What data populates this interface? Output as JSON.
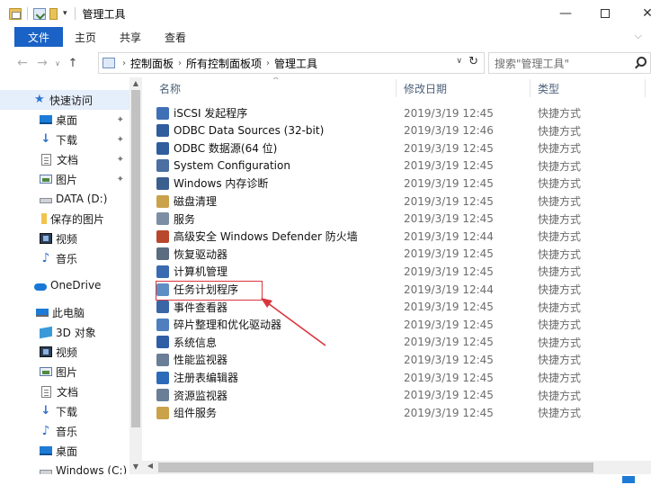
{
  "window": {
    "title": "管理工具",
    "minimize": "—",
    "close": "✕"
  },
  "ribbon": {
    "tabs": [
      "文件",
      "主页",
      "共享",
      "查看"
    ],
    "chevron": "⌵"
  },
  "nav": {
    "back": "←",
    "forward": "→",
    "recent": "∨",
    "up": "↑"
  },
  "address": {
    "crumbs": [
      "控制面板",
      "所有控制面板项",
      "管理工具"
    ],
    "separator": "›",
    "dropdown": "∨",
    "refresh": "↻"
  },
  "search": {
    "placeholder": "搜索\"管理工具\""
  },
  "sidebar": {
    "pin": "✦",
    "items": [
      {
        "label": "快速访问",
        "icon": "star-icon",
        "pinned": false
      },
      {
        "label": "桌面",
        "icon": "desktop-icon",
        "pinned": true
      },
      {
        "label": "下载",
        "icon": "download-icon",
        "pinned": true
      },
      {
        "label": "文档",
        "icon": "document-icon",
        "pinned": true
      },
      {
        "label": "图片",
        "icon": "pictures-icon",
        "pinned": true
      },
      {
        "label": "DATA (D:)",
        "icon": "drive-icon",
        "pinned": false
      },
      {
        "label": "保存的图片",
        "icon": "folder-icon",
        "pinned": false
      },
      {
        "label": "视频",
        "icon": "video-icon",
        "pinned": false
      },
      {
        "label": "音乐",
        "icon": "music-icon",
        "pinned": false
      },
      {
        "label": "OneDrive",
        "icon": "onedrive-icon",
        "pinned": false
      },
      {
        "label": "此电脑",
        "icon": "this-pc-icon",
        "pinned": false
      },
      {
        "label": "3D 对象",
        "icon": "3d-objects-icon",
        "pinned": false
      },
      {
        "label": "视频",
        "icon": "video-icon",
        "pinned": false
      },
      {
        "label": "图片",
        "icon": "pictures-icon",
        "pinned": false
      },
      {
        "label": "文档",
        "icon": "document-icon",
        "pinned": false
      },
      {
        "label": "下载",
        "icon": "download-icon",
        "pinned": false
      },
      {
        "label": "音乐",
        "icon": "music-icon",
        "pinned": false
      },
      {
        "label": "桌面",
        "icon": "desktop-icon",
        "pinned": false
      },
      {
        "label": "Windows (C:)",
        "icon": "windows-drive-icon",
        "pinned": false
      }
    ]
  },
  "columns": {
    "name": "名称",
    "date": "修改日期",
    "type": "类型"
  },
  "files": [
    {
      "name": "iSCSI 发起程序",
      "date": "2019/3/19 12:45",
      "type": "快捷方式",
      "color": "#3f6fb5"
    },
    {
      "name": "ODBC Data Sources (32-bit)",
      "date": "2019/3/19 12:46",
      "type": "快捷方式",
      "color": "#2f5d9e"
    },
    {
      "name": "ODBC 数据源(64 位)",
      "date": "2019/3/19 12:45",
      "type": "快捷方式",
      "color": "#2f5d9e"
    },
    {
      "name": "System Configuration",
      "date": "2019/3/19 12:45",
      "type": "快捷方式",
      "color": "#4a6fa0"
    },
    {
      "name": "Windows 内存诊断",
      "date": "2019/3/19 12:45",
      "type": "快捷方式",
      "color": "#3b5f8f"
    },
    {
      "name": "磁盘清理",
      "date": "2019/3/19 12:45",
      "type": "快捷方式",
      "color": "#c9a24a"
    },
    {
      "name": "服务",
      "date": "2019/3/19 12:45",
      "type": "快捷方式",
      "color": "#7c8ea3"
    },
    {
      "name": "高级安全 Windows Defender 防火墙",
      "date": "2019/3/19 12:44",
      "type": "快捷方式",
      "color": "#b8472e"
    },
    {
      "name": "恢复驱动器",
      "date": "2019/3/19 12:45",
      "type": "快捷方式",
      "color": "#5b6c80"
    },
    {
      "name": "计算机管理",
      "date": "2019/3/19 12:45",
      "type": "快捷方式",
      "color": "#3a6ab0"
    },
    {
      "name": "任务计划程序",
      "date": "2019/3/19 12:44",
      "type": "快捷方式",
      "color": "#5e8fc4"
    },
    {
      "name": "事件查看器",
      "date": "2019/3/19 12:45",
      "type": "快捷方式",
      "color": "#3a66a8"
    },
    {
      "name": "碎片整理和优化驱动器",
      "date": "2019/3/19 12:45",
      "type": "快捷方式",
      "color": "#4f7fbf"
    },
    {
      "name": "系统信息",
      "date": "2019/3/19 12:45",
      "type": "快捷方式",
      "color": "#2f5ea5"
    },
    {
      "name": "性能监视器",
      "date": "2019/3/19 12:45",
      "type": "快捷方式",
      "color": "#6a7f97"
    },
    {
      "name": "注册表编辑器",
      "date": "2019/3/19 12:45",
      "type": "快捷方式",
      "color": "#2d6bb8"
    },
    {
      "name": "资源监视器",
      "date": "2019/3/19 12:45",
      "type": "快捷方式",
      "color": "#6a7f97"
    },
    {
      "name": "组件服务",
      "date": "2019/3/19 12:45",
      "type": "快捷方式",
      "color": "#c9a24a"
    }
  ],
  "annotation": {
    "highlight_color": "#d9363e"
  },
  "colors": {
    "accent": "#1a62c5",
    "selected": "#e5eefb"
  }
}
